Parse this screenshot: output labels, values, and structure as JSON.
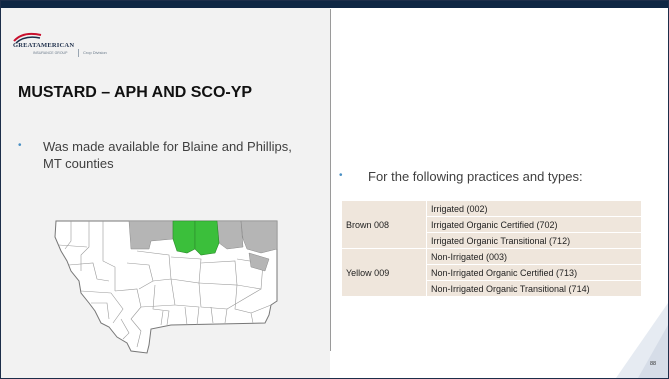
{
  "slide": {
    "title": "MUSTARD – APH AND SCO-YP",
    "left_bullet": "Was made available for Blaine and Phillips, MT counties",
    "right_bullet": "For the following practices and types:",
    "page_number": "88"
  },
  "logo": {
    "main_text": "GREATAMERICAN",
    "sub_text": "INSURANCE GROUP",
    "crop_text": "Crop Division"
  },
  "table": {
    "rows": [
      {
        "type": "Brown 008",
        "practices": [
          "Irrigated (002)",
          "Irrigated Organic Certified (702)",
          "Irrigated Organic Transitional (712)"
        ]
      },
      {
        "type": "Yellow 009",
        "practices": [
          "Non-Irrigated (003)",
          "Non-Irrigated Organic Certified (713)",
          "Non-Irrigated Organic Transitional (714)"
        ]
      }
    ]
  },
  "colors": {
    "header_bar": "#0f2744",
    "bullet": "#4a90c4",
    "highlight_counties": "#3bbf3b",
    "neighbor_counties": "#b5b5b5",
    "table_fill": "#efe6dc"
  }
}
